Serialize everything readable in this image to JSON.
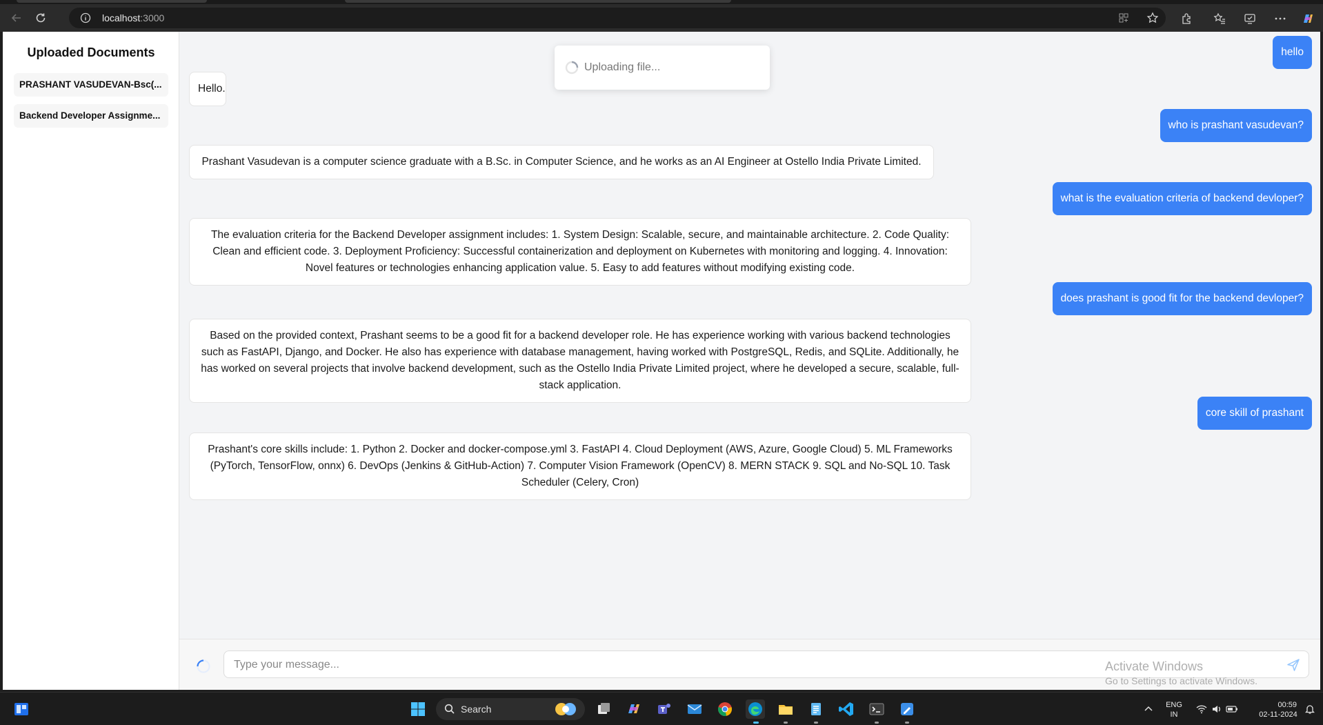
{
  "browser": {
    "url_host": "localhost",
    "url_port": ":3000"
  },
  "sidebar": {
    "title": "Uploaded Documents",
    "documents": [
      {
        "name": "PRASHANT VASUDEVAN-Bsc(..."
      },
      {
        "name": "Backend Developer Assignme..."
      }
    ]
  },
  "toast": {
    "label": "Uploading file..."
  },
  "messages": [
    {
      "role": "user",
      "text": "hello"
    },
    {
      "role": "bot",
      "text": "Hello."
    },
    {
      "role": "user",
      "text": "who is prashant vasudevan?"
    },
    {
      "role": "bot",
      "text": "Prashant Vasudevan is a computer science graduate with a B.Sc. in Computer Science, and he works as an AI Engineer at Ostello India Private Limited."
    },
    {
      "role": "user",
      "text": "what is the evaluation criteria of backend devloper?"
    },
    {
      "role": "bot",
      "text": "The evaluation criteria for the Backend Developer assignment includes: 1. System Design: Scalable, secure, and maintainable architecture. 2. Code Quality: Clean and efficient code. 3. Deployment Proficiency: Successful containerization and deployment on Kubernetes with monitoring and logging. 4. Innovation: Novel features or technologies enhancing application value. 5. Easy to add features without modifying existing code."
    },
    {
      "role": "user",
      "text": "does prashant is good fit for the backend devloper?"
    },
    {
      "role": "bot",
      "text": "Based on the provided context, Prashant seems to be a good fit for a backend developer role. He has experience working with various backend technologies such as FastAPI, Django, and Docker. He also has experience with database management, having worked with PostgreSQL, Redis, and SQLite. Additionally, he has worked on several projects that involve backend development, such as the Ostello India Private Limited project, where he developed a secure, scalable, full-stack application."
    },
    {
      "role": "user",
      "text": "core skill of prashant"
    },
    {
      "role": "bot",
      "text": "Prashant's core skills include: 1. Python 2. Docker and docker-compose.yml 3. FastAPI 4. Cloud Deployment (AWS, Azure, Google Cloud) 5. ML Frameworks (PyTorch, TensorFlow, onnx) 6. DevOps (Jenkins & GitHub-Action) 7. Computer Vision Framework (OpenCV) 8. MERN STACK 9. SQL and No-SQL 10. Task Scheduler (Celery, Cron)"
    }
  ],
  "composer": {
    "placeholder": "Type your message..."
  },
  "watermark": {
    "line1": "Activate Windows",
    "line2": "Go to Settings to activate Windows."
  },
  "taskbar": {
    "search_label": "Search",
    "lang_line1": "ENG",
    "lang_line2": "IN",
    "time": "00:59",
    "date": "02-11-2024"
  },
  "colors": {
    "user_bubble": "#3b82f6",
    "app_background": "#f3f4f6",
    "taskbar": "#1c1c1c"
  }
}
